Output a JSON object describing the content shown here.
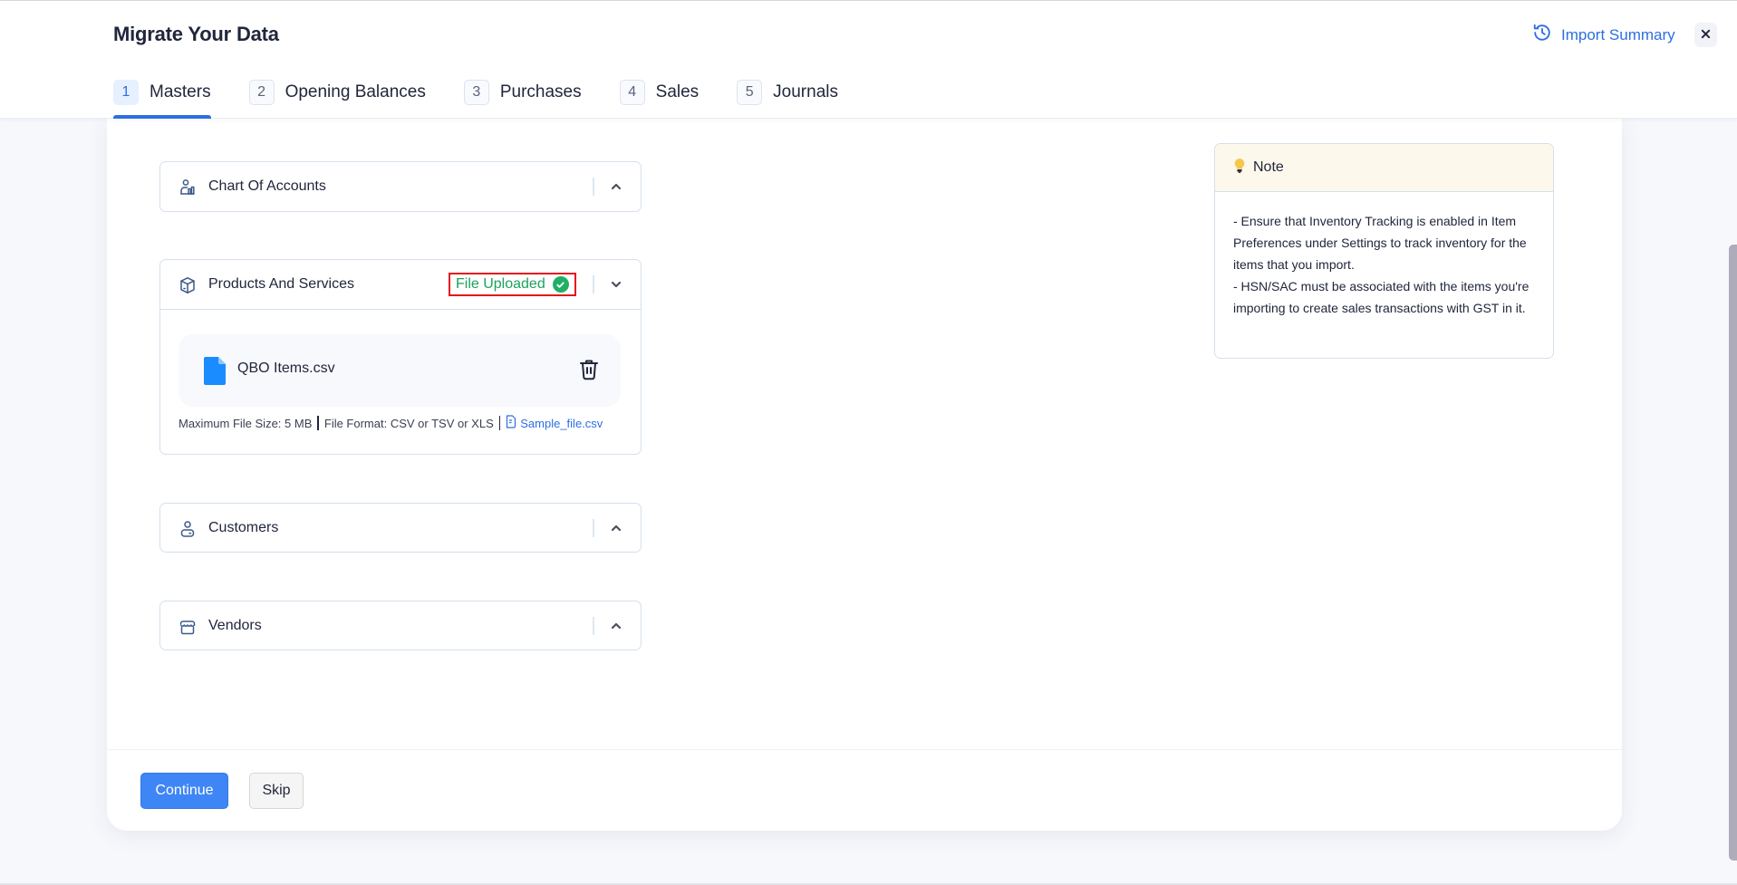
{
  "header": {
    "title": "Migrate Your Data",
    "import_summary_label": "Import Summary",
    "import_summary_icon": "history-icon",
    "close_icon": "close-icon"
  },
  "tabs": [
    {
      "num": "1",
      "label": "Masters",
      "active": true
    },
    {
      "num": "2",
      "label": "Opening Balances",
      "active": false
    },
    {
      "num": "3",
      "label": "Purchases",
      "active": false
    },
    {
      "num": "4",
      "label": "Sales",
      "active": false
    },
    {
      "num": "5",
      "label": "Journals",
      "active": false
    }
  ],
  "sections": {
    "chart_of_accounts": {
      "title": "Chart Of Accounts",
      "icon": "user-chart-icon",
      "expanded": false
    },
    "products_and_services": {
      "title": "Products And Services",
      "icon": "box-icon",
      "expanded": true,
      "status": "File Uploaded",
      "file_name": "QBO Items.csv",
      "meta_size": "Maximum File Size: 5 MB",
      "meta_format": "File Format: CSV or TSV or XLS",
      "sample_link": "Sample_file.csv"
    },
    "customers": {
      "title": "Customers",
      "icon": "user-icon",
      "expanded": false
    },
    "vendors": {
      "title": "Vendors",
      "icon": "store-icon",
      "expanded": false
    }
  },
  "note": {
    "title": "Note",
    "icon": "lightbulb-icon",
    "lines": [
      "- Ensure that Inventory Tracking is enabled in Item Preferences under Settings to track inventory for the items that you import.",
      "- HSN/SAC must be associated with the items you're importing to create sales transactions with GST in it."
    ]
  },
  "footer": {
    "continue_label": "Continue",
    "skip_label": "Skip"
  },
  "colors": {
    "accent": "#2d6fe0",
    "success": "#1ca35b",
    "highlight_border": "#e3161d",
    "primary_button": "#3e86f5"
  }
}
